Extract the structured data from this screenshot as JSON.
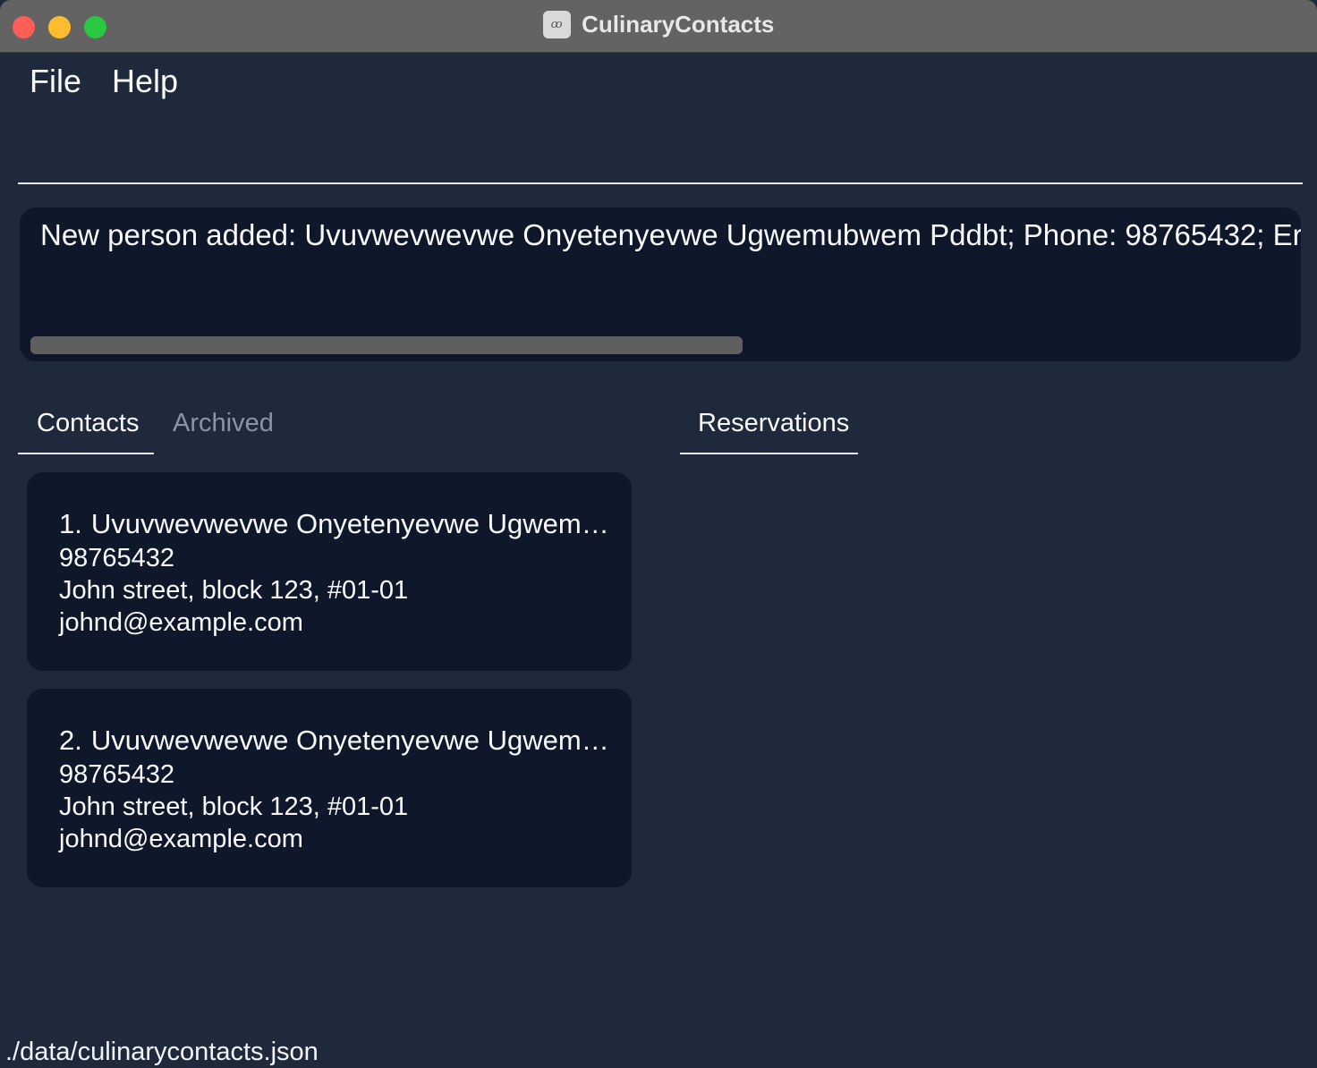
{
  "window": {
    "title": "CulinaryContacts",
    "icon": "app-logo-icon",
    "icon_glyph": "ꝏ"
  },
  "menu": {
    "file": "File",
    "help": "Help"
  },
  "command": {
    "value": "",
    "placeholder": ""
  },
  "result": {
    "text": "New person added: Uvuvwevwevwe Onyetenyevwe Ugwemubwem Pddbt; Phone: 98765432; Er"
  },
  "tabs": {
    "contacts": "Contacts",
    "archived": "Archived",
    "reservations": "Reservations"
  },
  "contacts": [
    {
      "index": "1.",
      "name": "Uvuvwevwevwe Onyetenyevwe Ugwemu...",
      "phone": "98765432",
      "address": "John street, block 123, #01-01",
      "email": "johnd@example.com"
    },
    {
      "index": "2.",
      "name": "Uvuvwevwevwe Onyetenyevwe Ugwemu...",
      "phone": "98765432",
      "address": "John street, block 123, #01-01",
      "email": "johnd@example.com"
    }
  ],
  "status": {
    "file_path": "./data/culinarycontacts.json"
  },
  "colors": {
    "background": "#1e293b",
    "panel": "#0f172a",
    "titlebar": "#636363",
    "accent_underline": "#e5e7eb",
    "inactive_tab": "#8a94a3"
  }
}
